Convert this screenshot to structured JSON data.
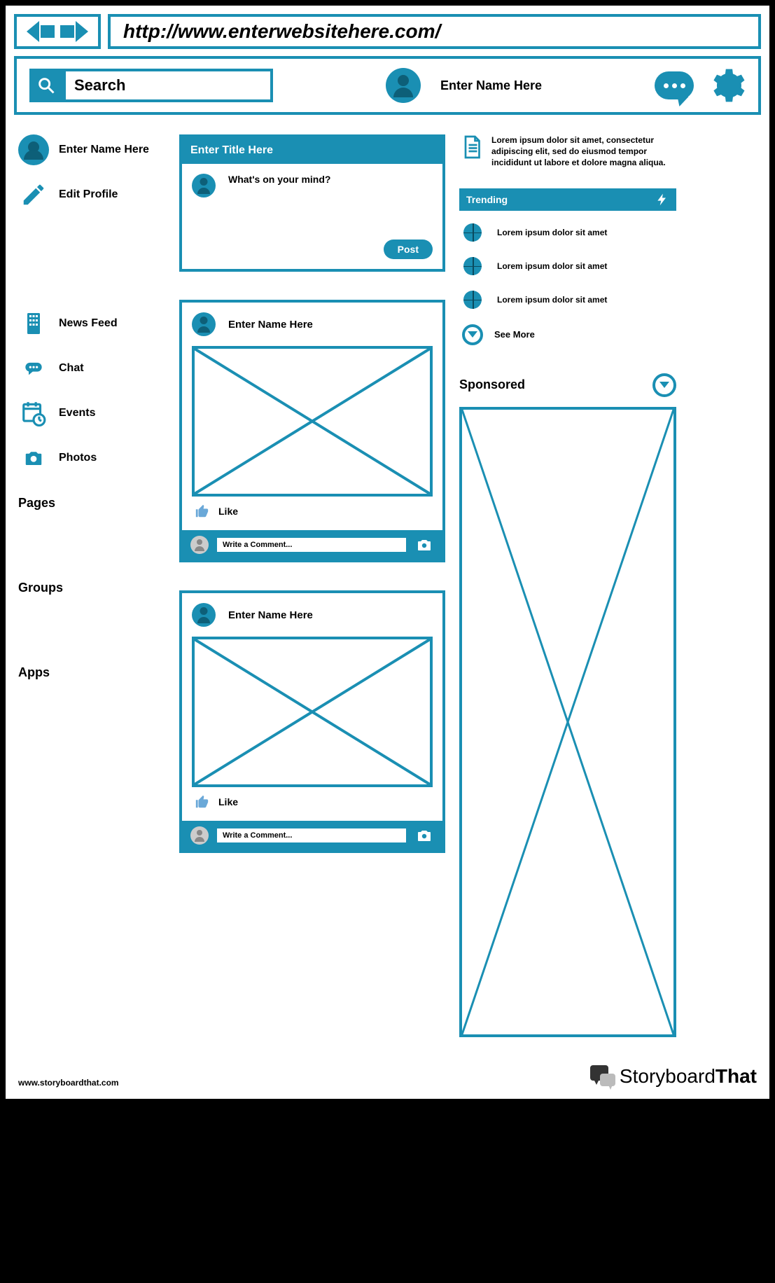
{
  "url": "http://www.enterwebsitehere.com/",
  "header": {
    "search_placeholder": "Search",
    "user_name": "Enter Name Here"
  },
  "sidebar": {
    "profile_name": "Enter Name Here",
    "edit_profile": "Edit Profile",
    "nav": [
      {
        "label": "News Feed",
        "icon": "building"
      },
      {
        "label": "Chat",
        "icon": "chat"
      },
      {
        "label": "Events",
        "icon": "calendar"
      },
      {
        "label": "Photos",
        "icon": "camera"
      }
    ],
    "sections": [
      "Pages",
      "Groups",
      "Apps"
    ]
  },
  "compose": {
    "title": "Enter Title Here",
    "prompt": "What's on your mind?",
    "post_btn": "Post"
  },
  "feed": [
    {
      "author": "Enter Name Here",
      "like_label": "Like",
      "comment_placeholder": "Write a Comment..."
    },
    {
      "author": "Enter Name Here",
      "like_label": "Like",
      "comment_placeholder": "Write a Comment..."
    }
  ],
  "right": {
    "news_text": "Lorem ipsum dolor sit amet, consectetur adipiscing elit, sed do eiusmod tempor incididunt ut labore et dolore magna aliqua.",
    "trending_label": "Trending",
    "trending_items": [
      "Lorem ipsum dolor sit amet",
      "Lorem ipsum dolor sit amet",
      "Lorem ipsum dolor sit amet"
    ],
    "see_more": "See More",
    "sponsored_label": "Sponsored"
  },
  "footer": {
    "url": "www.storyboardthat.com",
    "brand_prefix": "Storyboard",
    "brand_suffix": "That"
  }
}
